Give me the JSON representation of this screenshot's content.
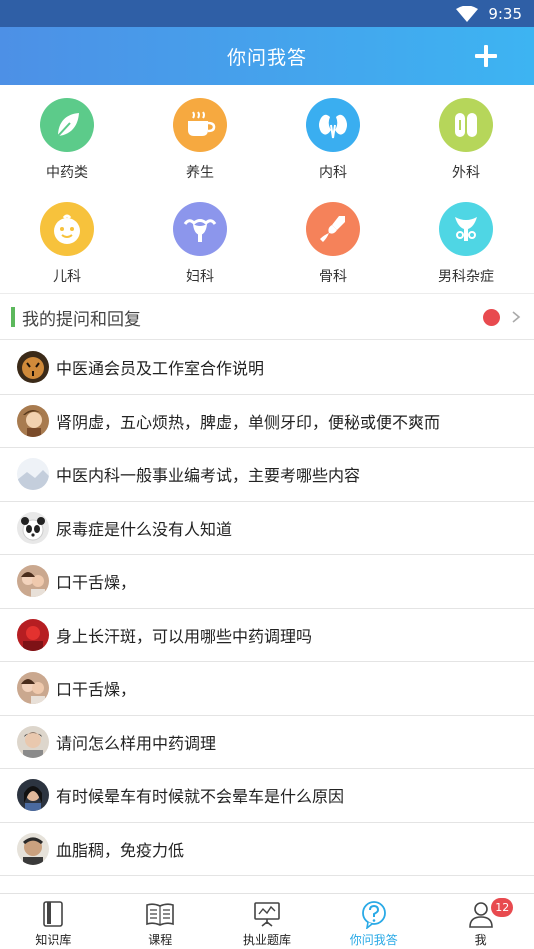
{
  "status": {
    "time": "9:35"
  },
  "header": {
    "title": "你问我答"
  },
  "categories": [
    {
      "label": "中药类",
      "icon": "leaf-icon",
      "color": "#5ccb8a"
    },
    {
      "label": "养生",
      "icon": "tea-cup-icon",
      "color": "#f6a940"
    },
    {
      "label": "内科",
      "icon": "kidney-icon",
      "color": "#3aaef0"
    },
    {
      "label": "外科",
      "icon": "bandage-icon",
      "color": "#b6d65a"
    },
    {
      "label": "儿科",
      "icon": "baby-face-icon",
      "color": "#f7c23c"
    },
    {
      "label": "妇科",
      "icon": "uterus-icon",
      "color": "#8c96ec"
    },
    {
      "label": "骨科",
      "icon": "bone-joint-icon",
      "color": "#f5825a"
    },
    {
      "label": "男科杂症",
      "icon": "male-organ-icon",
      "color": "#4fd6e4"
    }
  ],
  "section": {
    "title": "我的提问和回复"
  },
  "questions": [
    {
      "text": "中医通会员及工作室合作说明",
      "avatar_color": "#8a5a2c"
    },
    {
      "text": "肾阴虚，五心烦热，脾虚，单侧牙印，便秘或便不爽而",
      "avatar_color": "#c49a6c"
    },
    {
      "text": "中医内科一般事业编考试，主要考哪些内容",
      "avatar_color": "#cfd8e6"
    },
    {
      "text": "尿毒症是什么没有人知道",
      "avatar_color": "#555555"
    },
    {
      "text": "口干舌燥，",
      "avatar_color": "#d9a38a"
    },
    {
      "text": "身上长汗斑，可以用哪些中药调理吗",
      "avatar_color": "#c8262c"
    },
    {
      "text": "口干舌燥，",
      "avatar_color": "#d9a38a"
    },
    {
      "text": "请问怎么样用中药调理",
      "avatar_color": "#b9b2a8"
    },
    {
      "text": "有时候晕车有时候就不会晕车是什么原因",
      "avatar_color": "#39404a"
    },
    {
      "text": "血脂稠，免疫力低",
      "avatar_color": "#6b5a45"
    }
  ],
  "tabs": [
    {
      "label": "知识库",
      "icon": "book-icon"
    },
    {
      "label": "课程",
      "icon": "open-book-icon"
    },
    {
      "label": "执业题库",
      "icon": "board-chart-icon"
    },
    {
      "label": "你问我答",
      "icon": "question-icon",
      "active": true
    },
    {
      "label": "我",
      "icon": "user-icon",
      "badge": "12"
    }
  ],
  "colors": {
    "accent": "#29a9e6",
    "header_start": "#4d90e6",
    "header_end": "#3db4f2",
    "badge": "#e84a4f",
    "section_bar": "#5cb85c"
  }
}
